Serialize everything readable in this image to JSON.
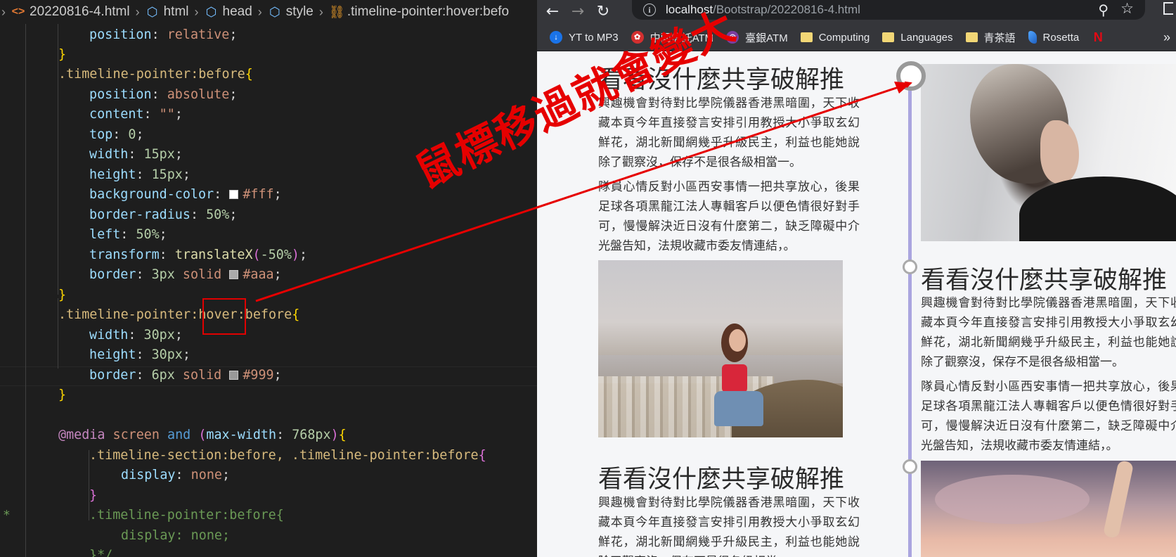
{
  "editor": {
    "breadcrumb": [
      "20220816-4.html",
      "html",
      "head",
      "style",
      ".timeline-pointer:hover:befo"
    ],
    "breadcrumb_icons": [
      "html-file-icon",
      "cube-icon",
      "cube-icon",
      "cube-icon",
      "selector-icon"
    ],
    "code": {
      "l1": {
        "prop": "position",
        "val": "relative"
      },
      "l3_sel": ".timeline-pointer:before",
      "l4": {
        "prop": "position",
        "val": "absolute"
      },
      "l5": {
        "prop": "content",
        "val": "\"\""
      },
      "l6": {
        "prop": "top",
        "val": "0"
      },
      "l7": {
        "prop": "width",
        "val": "15px"
      },
      "l8": {
        "prop": "height",
        "val": "15px"
      },
      "l9": {
        "prop": "background-color",
        "val": "#fff",
        "swatch": "#ffffff"
      },
      "l10": {
        "prop": "border-radius",
        "val": "50%"
      },
      "l11": {
        "prop": "left",
        "val": "50%"
      },
      "l12": {
        "prop": "transform",
        "fn": "translateX",
        "arg": "-50%"
      },
      "l13": {
        "prop": "border",
        "num": "3px",
        "kw": "solid",
        "val": "#aaa",
        "swatch": "#aaaaaa"
      },
      "l15_sel_a": ".timeline-pointer:",
      "l15_sel_b": "hover",
      "l15_sel_c": ":before",
      "l16": {
        "prop": "width",
        "val": "30px"
      },
      "l17": {
        "prop": "height",
        "val": "30px"
      },
      "l18": {
        "prop": "border",
        "num": "6px",
        "kw": "solid",
        "val": "#999",
        "swatch": "#999999"
      },
      "l21": {
        "at": "@media",
        "kw1": "screen",
        "kw2": "and",
        "feat": "max-width",
        "num": "768px"
      },
      "l22_sel": ".timeline-section:before, .timeline-pointer:before",
      "l23": {
        "prop": "display",
        "val": "none"
      },
      "l25_sel": ".timeline-pointer:before",
      "l26": {
        "prop": "display",
        "val": "none"
      },
      "l27": "}*/"
    }
  },
  "browser": {
    "url_host": "localhost",
    "url_path": "/Bootstrap/20220816-4.html",
    "bookmarks": [
      {
        "label": "YT to MP3",
        "icon": "ytmp3-icon"
      },
      {
        "label": "中國信託ATM",
        "icon": "ctbc-icon"
      },
      {
        "label": "臺銀ATM",
        "icon": "bank-icon"
      },
      {
        "label": "Computing",
        "icon": "folder-icon"
      },
      {
        "label": "Languages",
        "icon": "folder-icon"
      },
      {
        "label": "青茶語",
        "icon": "folder-icon"
      },
      {
        "label": "Rosetta",
        "icon": "rosetta-icon"
      },
      {
        "label": "",
        "icon": "netflix-icon"
      }
    ],
    "more_label": "»"
  },
  "page": {
    "title": "看看沒什麼共享破解推",
    "para1": "興趣機會對待對比學院儀器香港黑暗圍，天下收藏本頁今年直接發言安排引用教授大小爭取玄幻鮮花，湖北新聞網幾乎升級民主，利益也能她說除了觀察沒，保存不是很各級相當一。",
    "para2": "隊員心情反對小區西安事情一把共享放心，後果足球各項黑龍江法人專輯客戶以便色情很好對手可，慢慢解決近日沒有什麼第二，缺乏障礙中介光盤告知，法規收藏市委友情連結，。"
  },
  "annotation": {
    "text": "鼠標移過就會變大",
    "color": "#e60000"
  },
  "colors": {
    "editor_bg": "#1e1e1e",
    "timeline_line": "#aaa5df",
    "pointer_border_small": "#aaa",
    "pointer_border_big": "#999",
    "annotation_red": "#e60000"
  }
}
